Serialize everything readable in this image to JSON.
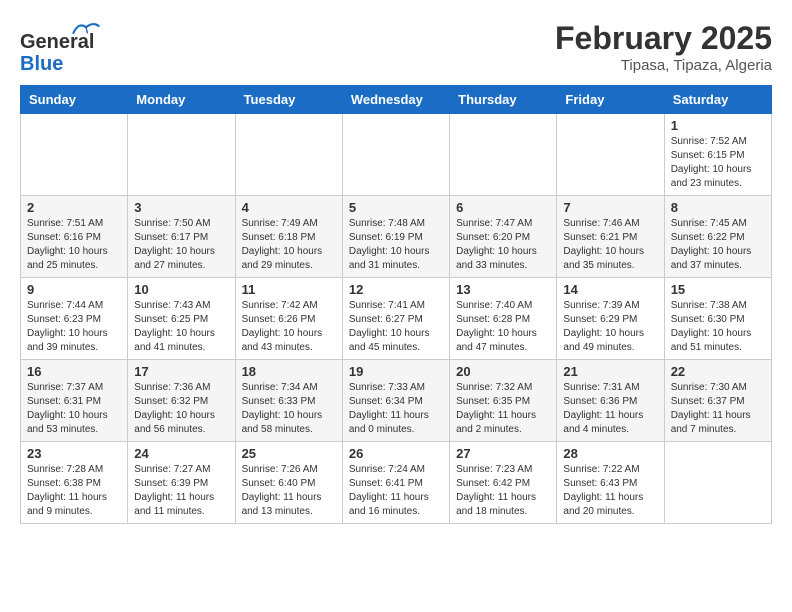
{
  "header": {
    "logo_line1": "General",
    "logo_line2": "Blue",
    "month": "February 2025",
    "location": "Tipasa, Tipaza, Algeria"
  },
  "days_of_week": [
    "Sunday",
    "Monday",
    "Tuesday",
    "Wednesday",
    "Thursday",
    "Friday",
    "Saturday"
  ],
  "weeks": [
    {
      "days": [
        {
          "num": "",
          "info": ""
        },
        {
          "num": "",
          "info": ""
        },
        {
          "num": "",
          "info": ""
        },
        {
          "num": "",
          "info": ""
        },
        {
          "num": "",
          "info": ""
        },
        {
          "num": "",
          "info": ""
        },
        {
          "num": "1",
          "info": "Sunrise: 7:52 AM\nSunset: 6:15 PM\nDaylight: 10 hours\nand 23 minutes."
        }
      ]
    },
    {
      "days": [
        {
          "num": "2",
          "info": "Sunrise: 7:51 AM\nSunset: 6:16 PM\nDaylight: 10 hours\nand 25 minutes."
        },
        {
          "num": "3",
          "info": "Sunrise: 7:50 AM\nSunset: 6:17 PM\nDaylight: 10 hours\nand 27 minutes."
        },
        {
          "num": "4",
          "info": "Sunrise: 7:49 AM\nSunset: 6:18 PM\nDaylight: 10 hours\nand 29 minutes."
        },
        {
          "num": "5",
          "info": "Sunrise: 7:48 AM\nSunset: 6:19 PM\nDaylight: 10 hours\nand 31 minutes."
        },
        {
          "num": "6",
          "info": "Sunrise: 7:47 AM\nSunset: 6:20 PM\nDaylight: 10 hours\nand 33 minutes."
        },
        {
          "num": "7",
          "info": "Sunrise: 7:46 AM\nSunset: 6:21 PM\nDaylight: 10 hours\nand 35 minutes."
        },
        {
          "num": "8",
          "info": "Sunrise: 7:45 AM\nSunset: 6:22 PM\nDaylight: 10 hours\nand 37 minutes."
        }
      ]
    },
    {
      "days": [
        {
          "num": "9",
          "info": "Sunrise: 7:44 AM\nSunset: 6:23 PM\nDaylight: 10 hours\nand 39 minutes."
        },
        {
          "num": "10",
          "info": "Sunrise: 7:43 AM\nSunset: 6:25 PM\nDaylight: 10 hours\nand 41 minutes."
        },
        {
          "num": "11",
          "info": "Sunrise: 7:42 AM\nSunset: 6:26 PM\nDaylight: 10 hours\nand 43 minutes."
        },
        {
          "num": "12",
          "info": "Sunrise: 7:41 AM\nSunset: 6:27 PM\nDaylight: 10 hours\nand 45 minutes."
        },
        {
          "num": "13",
          "info": "Sunrise: 7:40 AM\nSunset: 6:28 PM\nDaylight: 10 hours\nand 47 minutes."
        },
        {
          "num": "14",
          "info": "Sunrise: 7:39 AM\nSunset: 6:29 PM\nDaylight: 10 hours\nand 49 minutes."
        },
        {
          "num": "15",
          "info": "Sunrise: 7:38 AM\nSunset: 6:30 PM\nDaylight: 10 hours\nand 51 minutes."
        }
      ]
    },
    {
      "days": [
        {
          "num": "16",
          "info": "Sunrise: 7:37 AM\nSunset: 6:31 PM\nDaylight: 10 hours\nand 53 minutes."
        },
        {
          "num": "17",
          "info": "Sunrise: 7:36 AM\nSunset: 6:32 PM\nDaylight: 10 hours\nand 56 minutes."
        },
        {
          "num": "18",
          "info": "Sunrise: 7:34 AM\nSunset: 6:33 PM\nDaylight: 10 hours\nand 58 minutes."
        },
        {
          "num": "19",
          "info": "Sunrise: 7:33 AM\nSunset: 6:34 PM\nDaylight: 11 hours\nand 0 minutes."
        },
        {
          "num": "20",
          "info": "Sunrise: 7:32 AM\nSunset: 6:35 PM\nDaylight: 11 hours\nand 2 minutes."
        },
        {
          "num": "21",
          "info": "Sunrise: 7:31 AM\nSunset: 6:36 PM\nDaylight: 11 hours\nand 4 minutes."
        },
        {
          "num": "22",
          "info": "Sunrise: 7:30 AM\nSunset: 6:37 PM\nDaylight: 11 hours\nand 7 minutes."
        }
      ]
    },
    {
      "days": [
        {
          "num": "23",
          "info": "Sunrise: 7:28 AM\nSunset: 6:38 PM\nDaylight: 11 hours\nand 9 minutes."
        },
        {
          "num": "24",
          "info": "Sunrise: 7:27 AM\nSunset: 6:39 PM\nDaylight: 11 hours\nand 11 minutes."
        },
        {
          "num": "25",
          "info": "Sunrise: 7:26 AM\nSunset: 6:40 PM\nDaylight: 11 hours\nand 13 minutes."
        },
        {
          "num": "26",
          "info": "Sunrise: 7:24 AM\nSunset: 6:41 PM\nDaylight: 11 hours\nand 16 minutes."
        },
        {
          "num": "27",
          "info": "Sunrise: 7:23 AM\nSunset: 6:42 PM\nDaylight: 11 hours\nand 18 minutes."
        },
        {
          "num": "28",
          "info": "Sunrise: 7:22 AM\nSunset: 6:43 PM\nDaylight: 11 hours\nand 20 minutes."
        },
        {
          "num": "",
          "info": ""
        }
      ]
    }
  ]
}
